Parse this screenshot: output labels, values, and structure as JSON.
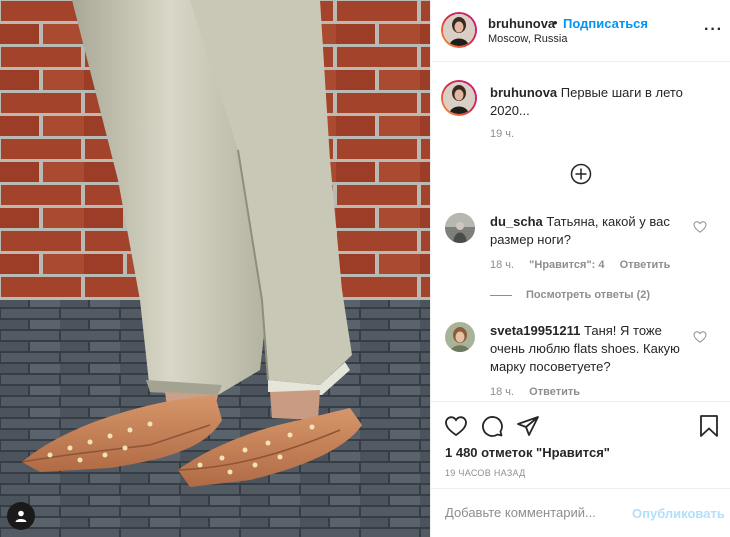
{
  "header": {
    "username": "bruhunova",
    "separator": "•",
    "follow_label": "Подписаться",
    "location": "Moscow, Russia",
    "more_label": "···"
  },
  "caption": {
    "username": "bruhunova",
    "text": "Первые шаги в лето 2020...",
    "time": "19 ч."
  },
  "comments": [
    {
      "username": "du_scha",
      "text": "Татьяна, какой у вас размер ноги?",
      "time": "18 ч.",
      "likes": "\"Нравится\": 4",
      "reply": "Ответить",
      "view_replies": "Посмотреть ответы (2)"
    },
    {
      "username": "sveta19951211",
      "text": "Таня! Я тоже очень люблю flats shoes. Какую марку посоветуете?",
      "time": "18 ч.",
      "reply": "Ответить"
    }
  ],
  "likes_text": "1 480 отметок \"Нравится\"",
  "post_time": "19 ЧАСОВ НАЗАД",
  "comment_input": {
    "placeholder": "Добавьте комментарий...",
    "publish_label": "Опубликовать"
  },
  "icons": {
    "like": "heart-icon",
    "comment": "comment-icon",
    "share": "share-icon",
    "save": "bookmark-icon",
    "more": "more-icon",
    "load_more": "plus-circle-icon",
    "user_tags": "user-tag-icon"
  },
  "colors": {
    "link": "#0095f6",
    "publish_disabled": "#b2dffc",
    "secondary_text": "#8e8e8e"
  }
}
